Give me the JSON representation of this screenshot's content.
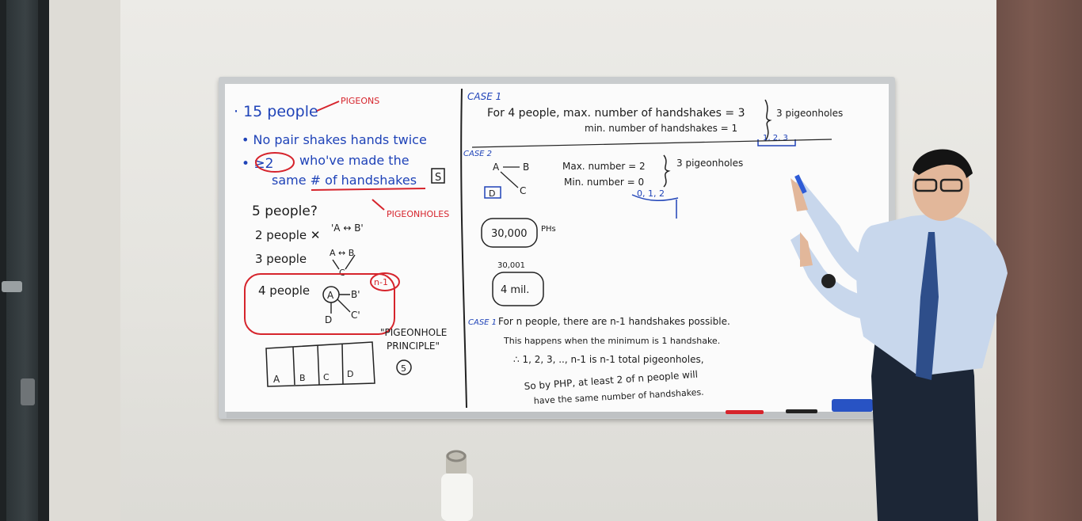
{
  "board": {
    "left": {
      "l1": "· 15 people",
      "l1_note": "PIGEONS",
      "l2": "• No pair shakes hands twice",
      "l3a": "• ≥2",
      "l3b": "who've made the",
      "l4": "same # of handshakes",
      "l4_badge": "S",
      "l5": "PIGEONHOLES",
      "l6": "5 people?",
      "l7": "2 people ✕",
      "l7b": "'A ↔ B'",
      "l8": "3 people",
      "l8b": "A ↔ B",
      "l8c": "C",
      "l9": "4 people",
      "l9_note": "n-1",
      "l9_a": "A",
      "l9_b": "B'",
      "l9_c": "C'",
      "l9_d": "D",
      "php1": "\"PIGEONHOLE",
      "php2": "PRINCIPLE\"",
      "php_num": "5",
      "boxes": [
        "A",
        "B",
        "C",
        "D"
      ]
    },
    "right": {
      "case1": "CASE 1",
      "c1a": "For 4 people,   max. number of handshakes = 3",
      "c1b": "min. number of handshakes = 1",
      "c1c": "3 pigeonholes",
      "c1d": "1, 2, 3",
      "case2": "CASE 2",
      "c2a": "Max. number = 2",
      "c2b": "Min. number = 0",
      "c2c": "3 pigeonholes",
      "c2d": "0, 1, 2",
      "c2_a": "A",
      "c2_b": "B",
      "c2_c": "C",
      "c2_d": "D",
      "ph1": "30,000",
      "ph1_unit": "PHs",
      "ph2": "30,001",
      "ph3": "4 mil.",
      "case1b": "CASE 1",
      "p1": "For n people, there are n-1 handshakes possible.",
      "p2": "This happens when the minimum is 1 handshake.",
      "p3": "∴ 1, 2, 3, .., n-1 is n-1 total pigeonholes,",
      "p4": "So by PHP, at least 2 of n people will",
      "p5": "have the same number of handshakes."
    }
  },
  "colors": {
    "blue_marker": "#1f43b8",
    "red_marker": "#d6242c",
    "black_marker": "#1b1b1b"
  }
}
